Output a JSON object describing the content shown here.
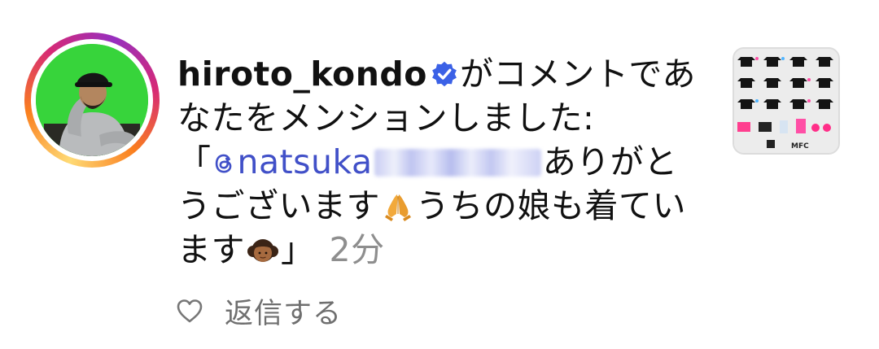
{
  "notification": {
    "username": "hiroto_kondo",
    "action_text": "がコメントであなたをメンションしました:",
    "quote_open": "「",
    "mention_text": "natsuka",
    "message_part1": "ありがとうございます",
    "message_part2": "うちの娘も着ています",
    "quote_close": "」",
    "timestamp": "2分"
  },
  "actions": {
    "reply_label": "返信する"
  },
  "post_thumbnail": {
    "caption": "MFC"
  },
  "colors": {
    "mention": "#4150c8",
    "verified": "#3b61e6",
    "timestamp": "#8e8e8e"
  },
  "icons": [
    "verified-badge-icon",
    "threads-mention-icon",
    "praying-hands-emoji",
    "girl-emoji",
    "heart-icon"
  ]
}
